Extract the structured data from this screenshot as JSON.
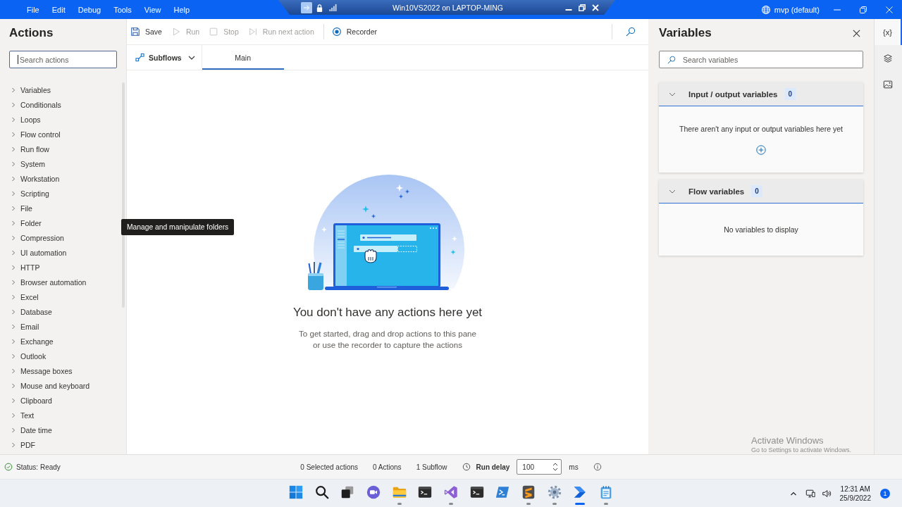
{
  "title_bar": {
    "menu": [
      "File",
      "Edit",
      "Debug",
      "Tools",
      "View",
      "Help"
    ],
    "remote_session": {
      "title": "Win10VS2022 on LAPTOP-MING"
    },
    "account": "mvp (default)"
  },
  "actions_panel": {
    "title": "Actions",
    "search": {
      "placeholder": "Search actions",
      "focused": true
    },
    "categories": [
      {
        "label": "Variables",
        "expanded": false
      },
      {
        "label": "Conditionals",
        "expanded": false
      },
      {
        "label": "Loops",
        "expanded": false
      },
      {
        "label": "Flow control",
        "expanded": false
      },
      {
        "label": "Run flow",
        "expanded": false
      },
      {
        "label": "System",
        "expanded": false
      },
      {
        "label": "Workstation",
        "expanded": false
      },
      {
        "label": "Scripting",
        "expanded": false
      },
      {
        "label": "File",
        "expanded": false
      },
      {
        "label": "Folder",
        "expanded": false
      },
      {
        "label": "Compression",
        "expanded": false
      },
      {
        "label": "UI automation",
        "expanded": false
      },
      {
        "label": "HTTP",
        "expanded": false
      },
      {
        "label": "Browser automation",
        "expanded": false
      },
      {
        "label": "Excel",
        "expanded": false
      },
      {
        "label": "Database",
        "expanded": false
      },
      {
        "label": "Email",
        "expanded": false
      },
      {
        "label": "Exchange",
        "expanded": false
      },
      {
        "label": "Outlook",
        "expanded": false
      },
      {
        "label": "Message boxes",
        "expanded": false
      },
      {
        "label": "Mouse and keyboard",
        "expanded": false
      },
      {
        "label": "Clipboard",
        "expanded": false
      },
      {
        "label": "Text",
        "expanded": false
      },
      {
        "label": "Date time",
        "expanded": false
      },
      {
        "label": "PDF",
        "expanded": false
      }
    ]
  },
  "tooltip": {
    "text": "Manage and manipulate folders"
  },
  "toolbar": {
    "buttons": [
      {
        "kind": "save",
        "label": "Save",
        "disabled": false
      },
      {
        "kind": "run",
        "label": "Run",
        "disabled": true
      },
      {
        "kind": "stop",
        "label": "Stop",
        "disabled": true
      },
      {
        "kind": "run_next",
        "label": "Run next action",
        "disabled": true
      },
      {
        "kind": "recorder",
        "label": "Recorder",
        "disabled": false
      }
    ]
  },
  "flow_tabs": {
    "subflows": {
      "label": "Subflows"
    },
    "tabs": [
      {
        "label": "Main",
        "selected": true
      }
    ]
  },
  "empty_state": {
    "title": "You don't have any actions here yet",
    "text": "To get started, drag and drop actions to this pane\nor use the recorder to capture the actions"
  },
  "variables_panel": {
    "title": "Variables",
    "search": {
      "placeholder": "Search variables"
    },
    "sections": [
      {
        "title": "Input / output variables",
        "count": "0",
        "expanded": true,
        "message": "There aren't any input or output variables here yet",
        "add_button": true
      },
      {
        "title": "Flow variables",
        "count": "0",
        "expanded": true,
        "message": "No variables to display",
        "add_button": false
      }
    ]
  },
  "side_rail": [
    {
      "kind": "variables",
      "label": "{x}",
      "selected": true
    },
    {
      "kind": "layers",
      "selected": false
    },
    {
      "kind": "images",
      "selected": false
    }
  ],
  "status_bar": {
    "status": "Status: Ready",
    "selected_actions": "0 Selected actions",
    "actions": "0 Actions",
    "subflows": "1 Subflow",
    "run_delay": {
      "label": "Run delay",
      "value": "100",
      "unit": "ms"
    }
  },
  "taskbar": {
    "apps": [
      {
        "kind": "start",
        "running": false,
        "selected": false
      },
      {
        "kind": "search",
        "running": false,
        "selected": false
      },
      {
        "kind": "task_view",
        "running": false,
        "selected": false
      },
      {
        "kind": "chat",
        "running": false,
        "selected": false
      },
      {
        "kind": "file_explorer",
        "running": true,
        "selected": false
      },
      {
        "kind": "terminal",
        "running": false,
        "selected": false
      },
      {
        "kind": "ide",
        "running": true,
        "selected": false
      },
      {
        "kind": "terminal",
        "running": false,
        "selected": false
      },
      {
        "kind": "shell",
        "running": false,
        "selected": false
      },
      {
        "kind": "text_editor",
        "running": true,
        "selected": false
      },
      {
        "kind": "settings",
        "running": true,
        "selected": false
      },
      {
        "kind": "automation",
        "running": true,
        "selected": true
      },
      {
        "kind": "notepad",
        "running": true,
        "selected": false
      }
    ],
    "tray": {
      "time": "12:31 AM",
      "date": "25/9/2022",
      "notifications": "1"
    }
  },
  "activation_notice": {
    "title": "Activate Windows",
    "text": "Go to Settings to activate Windows."
  }
}
